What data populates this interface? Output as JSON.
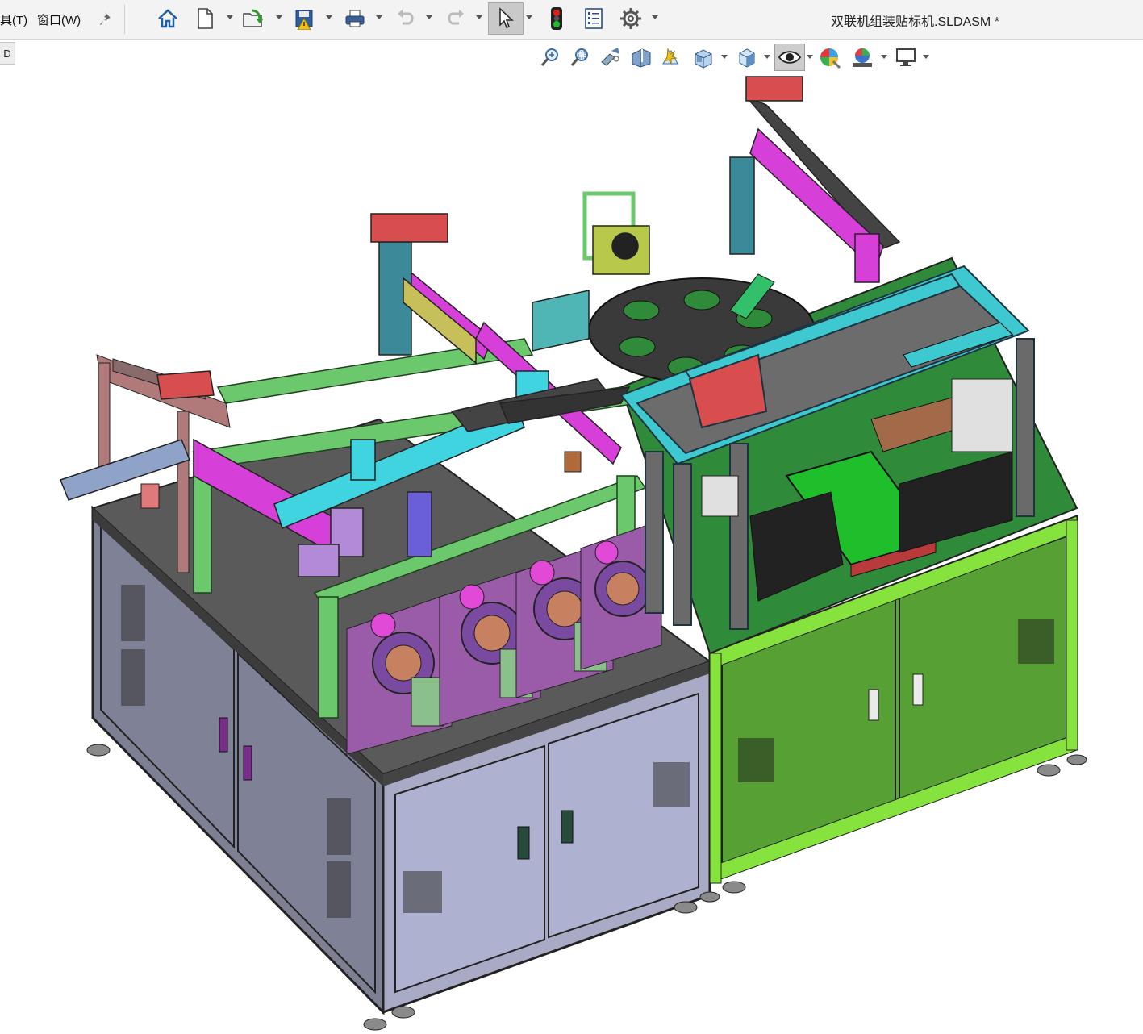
{
  "menubar": {
    "tools_label": "具(T)",
    "window_label": "窗口(W)"
  },
  "document": {
    "title": "双联机组装贴标机.SLDASM *"
  },
  "left_tab": {
    "label": "D"
  },
  "toolbar": {
    "icons": [
      "pin-icon",
      "home-icon",
      "new-document-icon",
      "open-icon",
      "save-icon",
      "print-icon",
      "undo-icon",
      "redo-icon",
      "select-icon",
      "traffic-light-icon",
      "file-properties-icon",
      "options-gear-icon"
    ]
  },
  "view_toolbar": {
    "icons": [
      "zoom-to-fit-icon",
      "zoom-to-area-icon",
      "previous-view-icon",
      "section-view-icon",
      "dynamic-annotation-icon",
      "view-orientation-icon",
      "display-style-icon",
      "hide-show-items-icon",
      "edit-appearance-icon",
      "apply-scene-icon",
      "view-settings-icon"
    ]
  },
  "colors": {
    "left_cabinet": "#9ea3bb",
    "right_cabinet": "#5aa637",
    "right_frame": "#7fe03a",
    "machine_green": "#6cc86c",
    "machine_magenta": "#d63fd8",
    "machine_cyan": "#3fd4e0",
    "tabletop_dark": "#585858",
    "tabletop_green": "#2f8a3a"
  }
}
